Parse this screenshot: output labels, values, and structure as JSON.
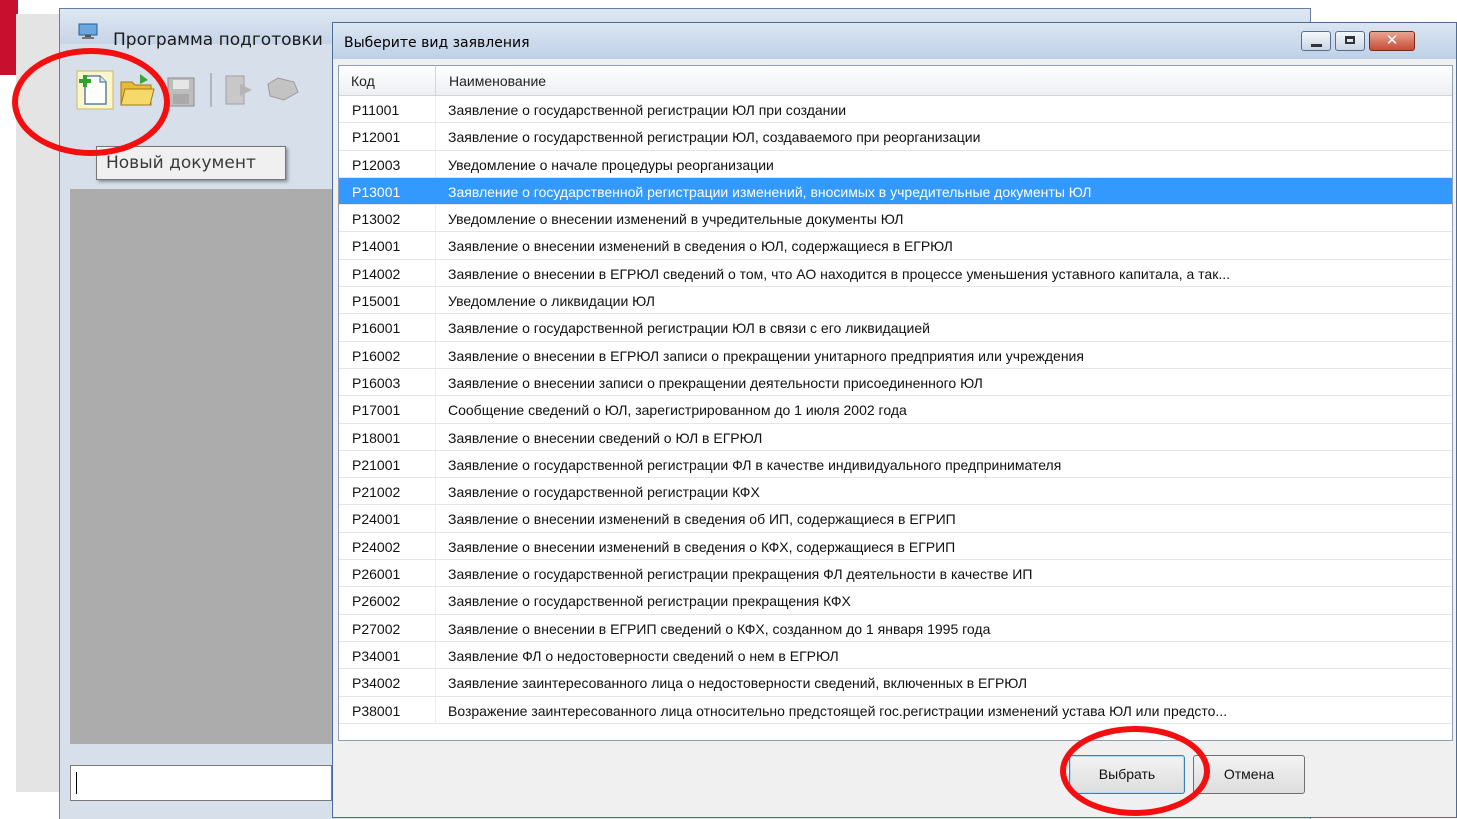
{
  "main_window": {
    "title": "Программа подготовки",
    "tooltip": "Новый документ",
    "toolbar": [
      {
        "icon": "new-document-icon"
      },
      {
        "icon": "open-folder-icon"
      },
      {
        "icon": "save-icon"
      },
      {
        "icon": "export-icon"
      },
      {
        "icon": "print-icon"
      }
    ]
  },
  "dialog": {
    "title": "Выберите вид заявления",
    "columns": {
      "code": "Код",
      "name": "Наименование"
    },
    "selected_index": 3,
    "rows": [
      {
        "code": "Р11001",
        "name": "Заявление о государственной регистрации ЮЛ при создании"
      },
      {
        "code": "Р12001",
        "name": "Заявление о государственной регистрации ЮЛ, создаваемого при реорганизации"
      },
      {
        "code": "Р12003",
        "name": "Уведомление о начале процедуры реорганизации"
      },
      {
        "code": "Р13001",
        "name": "Заявление о государственной регистрации изменений, вносимых в учредительные документы ЮЛ"
      },
      {
        "code": "Р13002",
        "name": "Уведомление о внесении изменений в учредительные документы ЮЛ"
      },
      {
        "code": "Р14001",
        "name": "Заявление о внесении изменений в сведения о ЮЛ, содержащиеся в ЕГРЮЛ"
      },
      {
        "code": "Р14002",
        "name": "Заявление о внесении в ЕГРЮЛ сведений о том, что АО находится в процессе уменьшения уставного капитала, а так..."
      },
      {
        "code": "Р15001",
        "name": "Уведомление о ликвидации ЮЛ"
      },
      {
        "code": "Р16001",
        "name": "Заявление о государственной регистрации ЮЛ в связи с его ликвидацией"
      },
      {
        "code": "Р16002",
        "name": "Заявление о внесении в ЕГРЮЛ записи о прекращении унитарного предприятия или учреждения"
      },
      {
        "code": "Р16003",
        "name": "Заявление о внесении записи о прекращении деятельности присоединенного ЮЛ"
      },
      {
        "code": "Р17001",
        "name": "Сообщение сведений о ЮЛ, зарегистрированном до 1 июля 2002 года"
      },
      {
        "code": "Р18001",
        "name": "Заявление о внесении сведений о ЮЛ в ЕГРЮЛ"
      },
      {
        "code": "Р21001",
        "name": "Заявление о государственной регистрации ФЛ в качестве индивидуального предпринимателя"
      },
      {
        "code": "Р21002",
        "name": "Заявление о государственной регистрации КФХ"
      },
      {
        "code": "Р24001",
        "name": "Заявление о внесении изменений в сведения об ИП, содержащиеся в ЕГРИП"
      },
      {
        "code": "Р24002",
        "name": "Заявление о внесении изменений в сведения о КФХ, содержащиеся в ЕГРИП"
      },
      {
        "code": "Р26001",
        "name": "Заявление о государственной регистрации прекращения ФЛ деятельности в качестве ИП"
      },
      {
        "code": "Р26002",
        "name": "Заявление о государственной регистрации прекращения КФХ"
      },
      {
        "code": "Р27002",
        "name": "Заявление о внесении в ЕГРИП сведений о КФХ, созданном до 1 января 1995 года"
      },
      {
        "code": "Р34001",
        "name": "Заявление ФЛ о недостоверности сведений о нем в ЕГРЮЛ"
      },
      {
        "code": "Р34002",
        "name": "Заявление заинтересованного лица о недостоверности сведений, включенных в ЕГРЮЛ"
      },
      {
        "code": "Р38001",
        "name": "Возражение заинтересованного лица относительно предстоящей гос.регистрации изменений устава ЮЛ или предсто..."
      }
    ],
    "buttons": {
      "select": "Выбрать",
      "cancel": "Отмена"
    },
    "window_buttons": {
      "close_glyph": "✕"
    }
  },
  "colors": {
    "selection": "#3399ff",
    "highlight_circle": "#f30f0f",
    "brand_bar": "#c8102e"
  }
}
